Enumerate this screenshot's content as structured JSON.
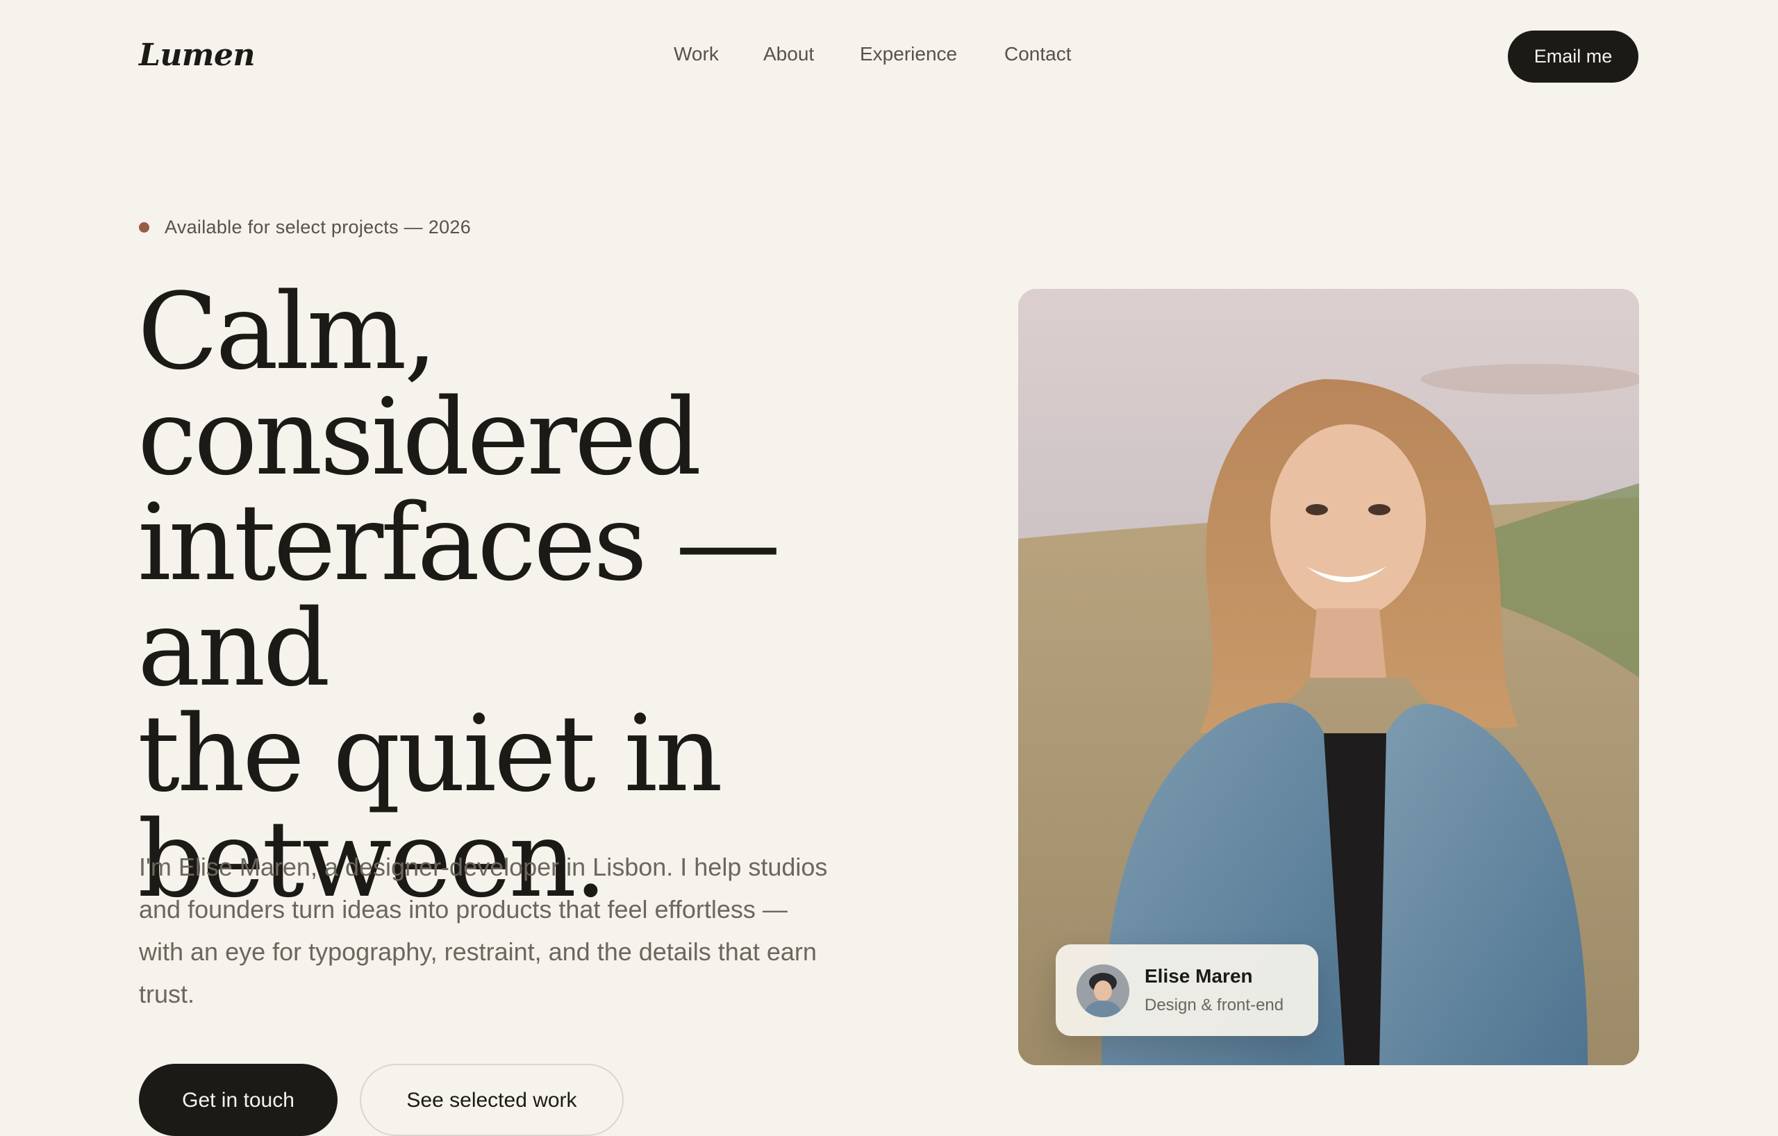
{
  "brand": {
    "logo_text": "Lumen"
  },
  "nav": {
    "items": [
      {
        "label": "Work"
      },
      {
        "label": "About"
      },
      {
        "label": "Experience"
      },
      {
        "label": "Contact"
      }
    ],
    "cta_label": "Email me"
  },
  "hero": {
    "availability": "Available for select projects — 2026",
    "headline_lines": [
      "Calm,",
      "considered",
      "interfaces — and",
      "the quiet in",
      "between."
    ],
    "intro": "I'm Elise Maren, a designer-developer in Lisbon. I help studios and founders turn ideas into products that feel effortless — with an eye for typography, restraint, and the details that earn trust.",
    "primary_button": "Get in touch",
    "secondary_button": "See selected work"
  },
  "profile_card": {
    "name": "Elise Maren",
    "role": "Design & front-end"
  },
  "colors": {
    "background": "#f6f3ec",
    "ink": "#1c1a17",
    "muted": "#6b665e",
    "accent_dot": "#9a5a44"
  }
}
